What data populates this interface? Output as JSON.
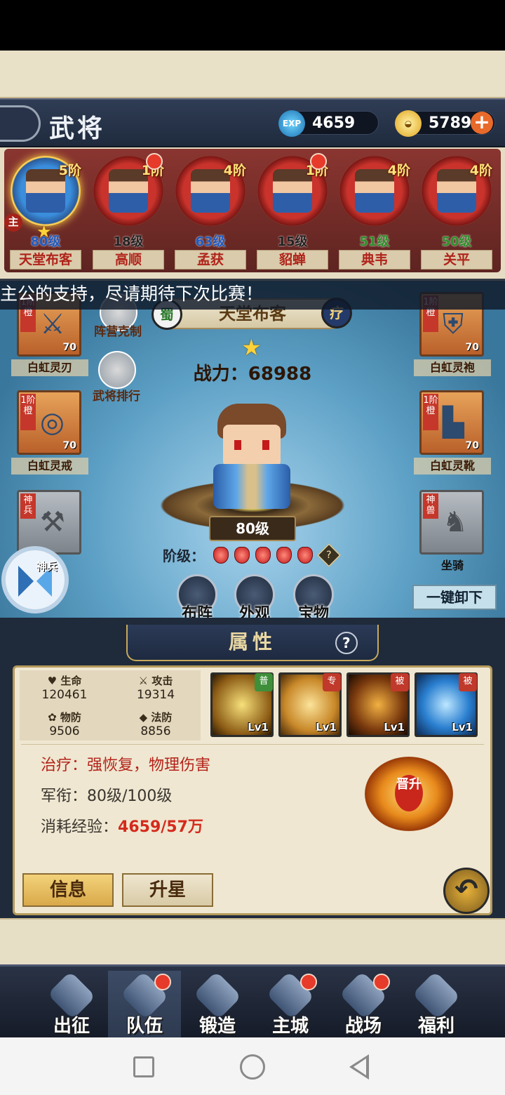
{
  "header": {
    "title": "武将",
    "exp_icon": "EXP",
    "exp": "4659",
    "gold": "5789",
    "add_label": "+"
  },
  "heroes": [
    {
      "rank": "5阶",
      "level": "80级",
      "name": "天堂布客",
      "selected": true,
      "main_tag": "主"
    },
    {
      "rank": "1阶",
      "level": "18级",
      "name": "高顺",
      "dot": true
    },
    {
      "rank": "4阶",
      "level": "63级",
      "name": "孟获"
    },
    {
      "rank": "1阶",
      "level": "15级",
      "name": "貂蝉",
      "dot": true
    },
    {
      "rank": "4阶",
      "level": "51级",
      "name": "典韦"
    },
    {
      "rank": "4阶",
      "level": "50级",
      "name": "关平"
    }
  ],
  "marquee": "主公的支持，尽请期待下次比赛！",
  "equipment": {
    "left": [
      {
        "tag": "1阶橙",
        "level": "70",
        "name": "白虹灵刃",
        "icon": "sword-icon"
      },
      {
        "tag": "1阶橙",
        "level": "70",
        "name": "白虹灵戒",
        "icon": "ring-icon"
      },
      {
        "tag": "神兵",
        "level": "",
        "name": "神兵",
        "icon": "divine-weapon-icon"
      }
    ],
    "right": [
      {
        "tag": "1阶橙",
        "level": "70",
        "name": "白虹灵袍",
        "icon": "armor-icon"
      },
      {
        "tag": "1阶橙",
        "level": "70",
        "name": "白虹灵靴",
        "icon": "boots-icon"
      },
      {
        "tag": "神兽",
        "level": "",
        "name": "坐骑",
        "icon": "mount-icon"
      }
    ]
  },
  "side_buttons": {
    "restraint": "阵营克制",
    "ranking": "武将排行"
  },
  "hero_detail": {
    "faction": "蜀",
    "role": "疗",
    "name": "天堂布客",
    "power_label": "战力：",
    "power": "68988",
    "level": "80级",
    "grade_label": "阶级：",
    "grade_gems": 5,
    "help": "?"
  },
  "actions": {
    "formation": "布阵",
    "appearance": "外观",
    "treasure": "宝物",
    "unequip_all": "一键卸下"
  },
  "panel": {
    "title": "属性",
    "help": "?",
    "stats": [
      {
        "label": "生命",
        "value": "120461"
      },
      {
        "label": "攻击",
        "value": "19314"
      },
      {
        "label": "物防",
        "value": "9506"
      },
      {
        "label": "法防",
        "value": "8856"
      }
    ],
    "skills": [
      {
        "badge": "普",
        "level": "Lv1",
        "badge_color": "#3f8f3a"
      },
      {
        "badge": "专",
        "level": "Lv1",
        "badge_color": "#c0392b"
      },
      {
        "badge": "被",
        "level": "Lv1",
        "badge_color": "#c0392b"
      },
      {
        "badge": "被",
        "level": "Lv1",
        "badge_color": "#c0392b"
      }
    ],
    "traits": "治疗：强恢复，物理伤害",
    "rank_label": "军衔：",
    "rank_value": "80级/100级",
    "exp_label": "消耗经验：",
    "exp_value": "4659/57万",
    "promote": "晋升",
    "info_tab": "信息",
    "star_tab": "升星"
  },
  "nav": [
    {
      "label": "出征",
      "dot": false
    },
    {
      "label": "队伍",
      "dot": true,
      "active": true
    },
    {
      "label": "锻造",
      "dot": false
    },
    {
      "label": "主城",
      "dot": true
    },
    {
      "label": "战场",
      "dot": true
    },
    {
      "label": "福利",
      "dot": false
    }
  ],
  "colors": {
    "accent_red": "#c0231a",
    "gold": "#ffd54a",
    "exp_value": "#d42a1c"
  }
}
